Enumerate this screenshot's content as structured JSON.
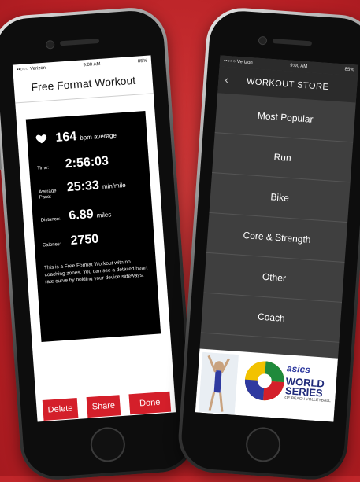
{
  "left_phone": {
    "status": {
      "carrier": "••○○○ Verizon",
      "time": "9:00 AM",
      "battery": "85%"
    },
    "title": "Free Format Workout",
    "stats": {
      "heart_rate": "164",
      "heart_rate_unit": "bpm average",
      "time_label": "Time:",
      "time_value": "2:56:03",
      "pace_label": "Average Pace:",
      "pace_value": "25:33",
      "pace_unit": "min/mile",
      "distance_label": "Distance:",
      "distance_value": "6.89",
      "distance_unit": "miles",
      "calories_label": "Calories:",
      "calories_value": "2750"
    },
    "description": "This is a Free Format Workout with no coaching zones. You can see a detailed heart rate curve by holding your device sideways.",
    "buttons": {
      "delete": "Delete",
      "share": "Share",
      "done": "Done"
    }
  },
  "right_phone": {
    "status": {
      "carrier": "••○○○ Verizon",
      "time": "9:00 AM",
      "battery": "85%"
    },
    "header": {
      "title": "WORKOUT STORE",
      "back_icon": "chevron-left-icon"
    },
    "menu": [
      {
        "label": "Most Popular"
      },
      {
        "label": "Run"
      },
      {
        "label": "Bike"
      },
      {
        "label": "Core & Strength"
      },
      {
        "label": "Other"
      },
      {
        "label": "Coach"
      }
    ],
    "banner": {
      "brand": "asics",
      "line1": "WORLD",
      "line2": "SERIES",
      "tagline": "OF BEACH VOLLEYBALL"
    }
  },
  "colors": {
    "background": "#c0262a",
    "accent": "#d41f2a",
    "store_bg": "#3f3f3f"
  }
}
